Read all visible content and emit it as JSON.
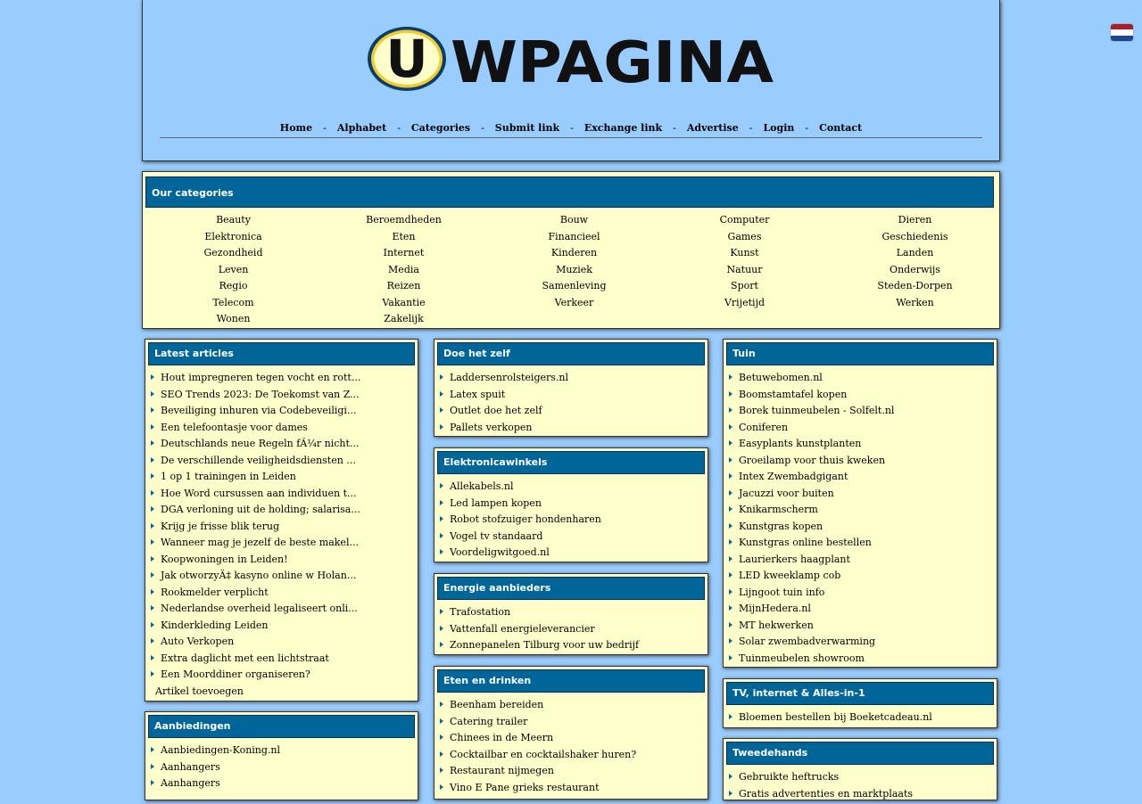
{
  "header": {
    "logo_text_u": "U",
    "logo_text_rest": "WPAGINA"
  },
  "flag": {
    "name": "netherlands-flag-icon",
    "colors": [
      "#ae1c28",
      "#ffffff",
      "#21468b"
    ]
  },
  "nav": {
    "items": [
      "Home",
      "Alphabet",
      "Categories",
      "Submit link",
      "Exchange link",
      "Advertise",
      "Login",
      "Contact"
    ],
    "separator": "-"
  },
  "categories": {
    "title": "Our categories",
    "items": [
      "Beauty",
      "Beroemdheden",
      "Bouw",
      "Computer",
      "Dieren",
      "Elektronica",
      "Eten",
      "Financieel",
      "Games",
      "Geschiedenis",
      "Gezondheid",
      "Internet",
      "Kinderen",
      "Kunst",
      "Landen",
      "Leven",
      "Media",
      "Muziek",
      "Natuur",
      "Onderwijs",
      "Regio",
      "Reizen",
      "Samenleving",
      "Sport",
      "Steden-Dorpen",
      "Telecom",
      "Vakantie",
      "Verkeer",
      "Vrijetijd",
      "Werken",
      "Wonen",
      "Zakelijk"
    ]
  },
  "boxes": {
    "latest": {
      "title": "Latest articles",
      "items": [
        "Hout impregneren tegen vocht en rott...",
        "SEO Trends 2023: De Toekomst van Z...",
        "Beveiliging inhuren via Codebeveiligi...",
        "Een telefoontasje voor dames",
        "Deutschlands neue Regeln fÃ¼r nicht...",
        "De verschillende veiligheidsdiensten ...",
        "1 op 1 trainingen in Leiden",
        "Hoe Word cursussen aan individuen t...",
        "DGA verloning uit de holding; salarisa...",
        "Krijg je frisse blik terug",
        "Wanneer mag je jezelf de beste makel...",
        "Koopwoningen in Leiden!",
        "Jak otworzyÄ‡ kasyno online w Holan...",
        "Rookmelder verplicht",
        "Nederlandse overheid legaliseert onli...",
        "Kinderkleding Leiden",
        "Auto Verkopen",
        "Extra daglicht met een lichtstraat",
        "Een Moorddiner organiseren?"
      ],
      "footer": "Artikel toevoegen"
    },
    "aanbiedingen": {
      "title": "Aanbiedingen",
      "items": [
        "Aanbiedingen-Koning.nl",
        "Aanhangers",
        "Aanhangers"
      ]
    },
    "doehetzelf": {
      "title": "Doe het zelf",
      "items": [
        "Laddersenrolsteigers.nl",
        "Latex spuit",
        "Outlet doe het zelf",
        "Pallets verkopen"
      ]
    },
    "elektronica": {
      "title": "Elektronicawinkels",
      "items": [
        "Allekabels.nl",
        "Led lampen kopen",
        "Robot stofzuiger hondenharen",
        "Vogel tv standaard",
        "Voordeligwitgoed.nl"
      ]
    },
    "energie": {
      "title": "Energie aanbieders",
      "items": [
        "Trafostation",
        "Vattenfall energieleverancier",
        "Zonnepanelen Tilburg voor uw bedrijf"
      ]
    },
    "eten": {
      "title": "Eten en drinken",
      "items": [
        "Beenham bereiden",
        "Catering trailer",
        "Chinees in de Meern",
        "Cocktailbar en cocktailshaker huren?",
        "Restaurant nijmegen",
        "Vino E Pane grieks restaurant"
      ]
    },
    "tuin": {
      "title": "Tuin",
      "items": [
        "Betuwebomen.nl",
        "Boomstamtafel kopen",
        "Borek tuinmeubelen - Solfelt.nl",
        "Coniferen",
        "Easyplants kunstplanten",
        "Groeilamp voor thuis kweken",
        "Intex Zwembadgigant",
        "Jacuzzi voor buiten",
        "Knikarmscherm",
        "Kunstgras kopen",
        "Kunstgras online bestellen",
        "Laurierkers haagplant",
        "LED kweeklamp cob",
        "Lijngoot tuin info",
        "MijnHedera.nl",
        "MT hekwerken",
        "Solar zwembadverwarming",
        "Tuinmeubelen showroom"
      ]
    },
    "tv": {
      "title": "TV, internet & Alles-in-1",
      "items": [
        "Bloemen bestellen bij Boeketcadeau.nl"
      ]
    },
    "tweedehands": {
      "title": "Tweedehands",
      "items": [
        "Gebruikte heftrucks",
        "Gratis advertenties en marktplaats"
      ]
    }
  }
}
